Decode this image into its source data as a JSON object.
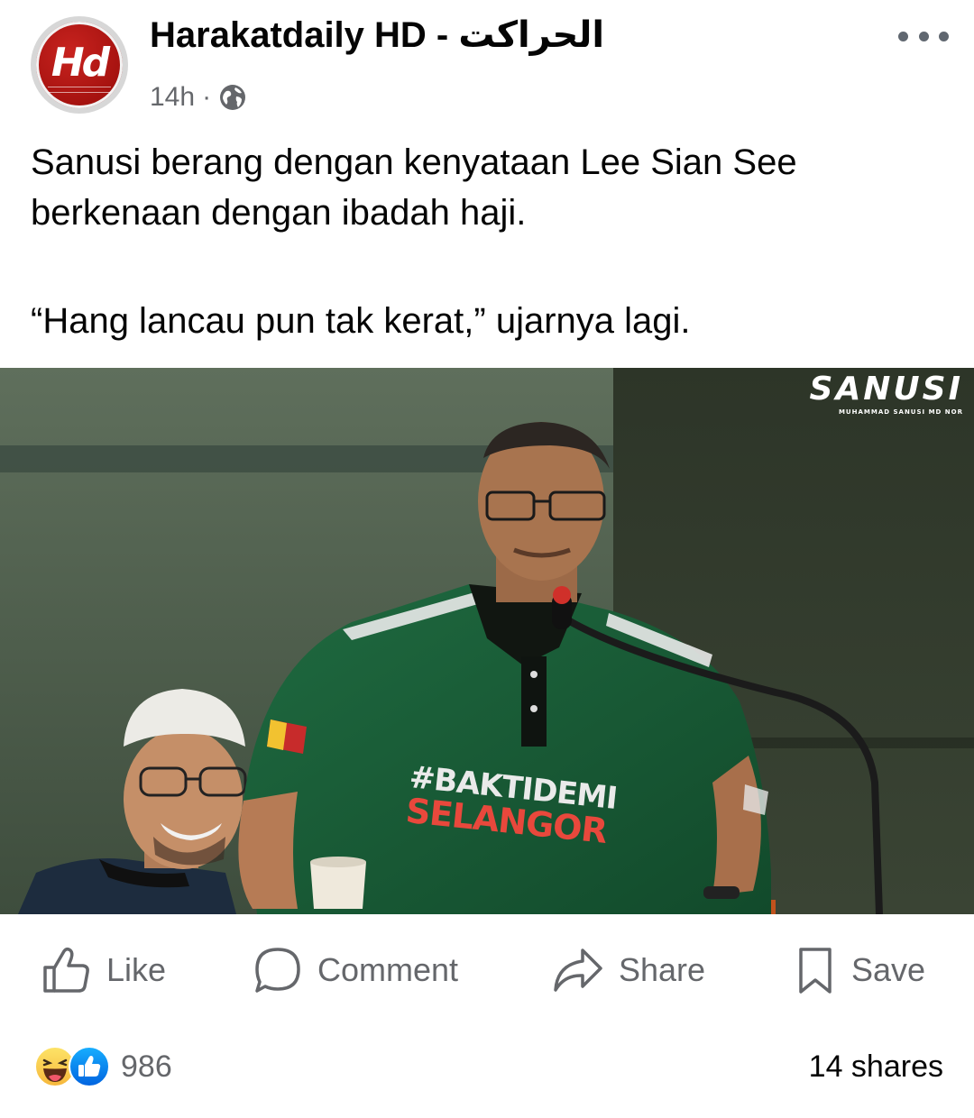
{
  "post": {
    "page_name": "Harakatdaily HD - الحراكت",
    "avatar_text": "Hd",
    "time": "14h",
    "separator": "·",
    "privacy_icon": "globe-icon",
    "more_icon": "more-dots-icon",
    "text_line1": "Sanusi berang dengan kenyataan Lee Sian See berkenaan dengan ibadah haji.",
    "text_line2": "“Hang lancau pun tak kerat,” ujarnya lagi."
  },
  "photo": {
    "watermark_main": "SANUSI",
    "watermark_sub": "MUHAMMAD SANUSI MD NOR",
    "shirt_line1": "#BAKTIDEMI",
    "shirt_line2": "SELANGOR"
  },
  "actions": {
    "like": {
      "label": "Like",
      "icon": "thumbs-up-icon"
    },
    "comment": {
      "label": "Comment",
      "icon": "comment-bubble-icon"
    },
    "share": {
      "label": "Share",
      "icon": "share-arrow-icon"
    },
    "save": {
      "label": "Save",
      "icon": "bookmark-icon"
    }
  },
  "footer": {
    "reaction_icons": [
      "haha-reaction-icon",
      "like-reaction-icon"
    ],
    "reaction_count": "986",
    "shares": "14 shares"
  },
  "colors": {
    "secondary_text": "#65676b",
    "like_blue": "#1877f2",
    "brand_red": "#b3140f"
  }
}
